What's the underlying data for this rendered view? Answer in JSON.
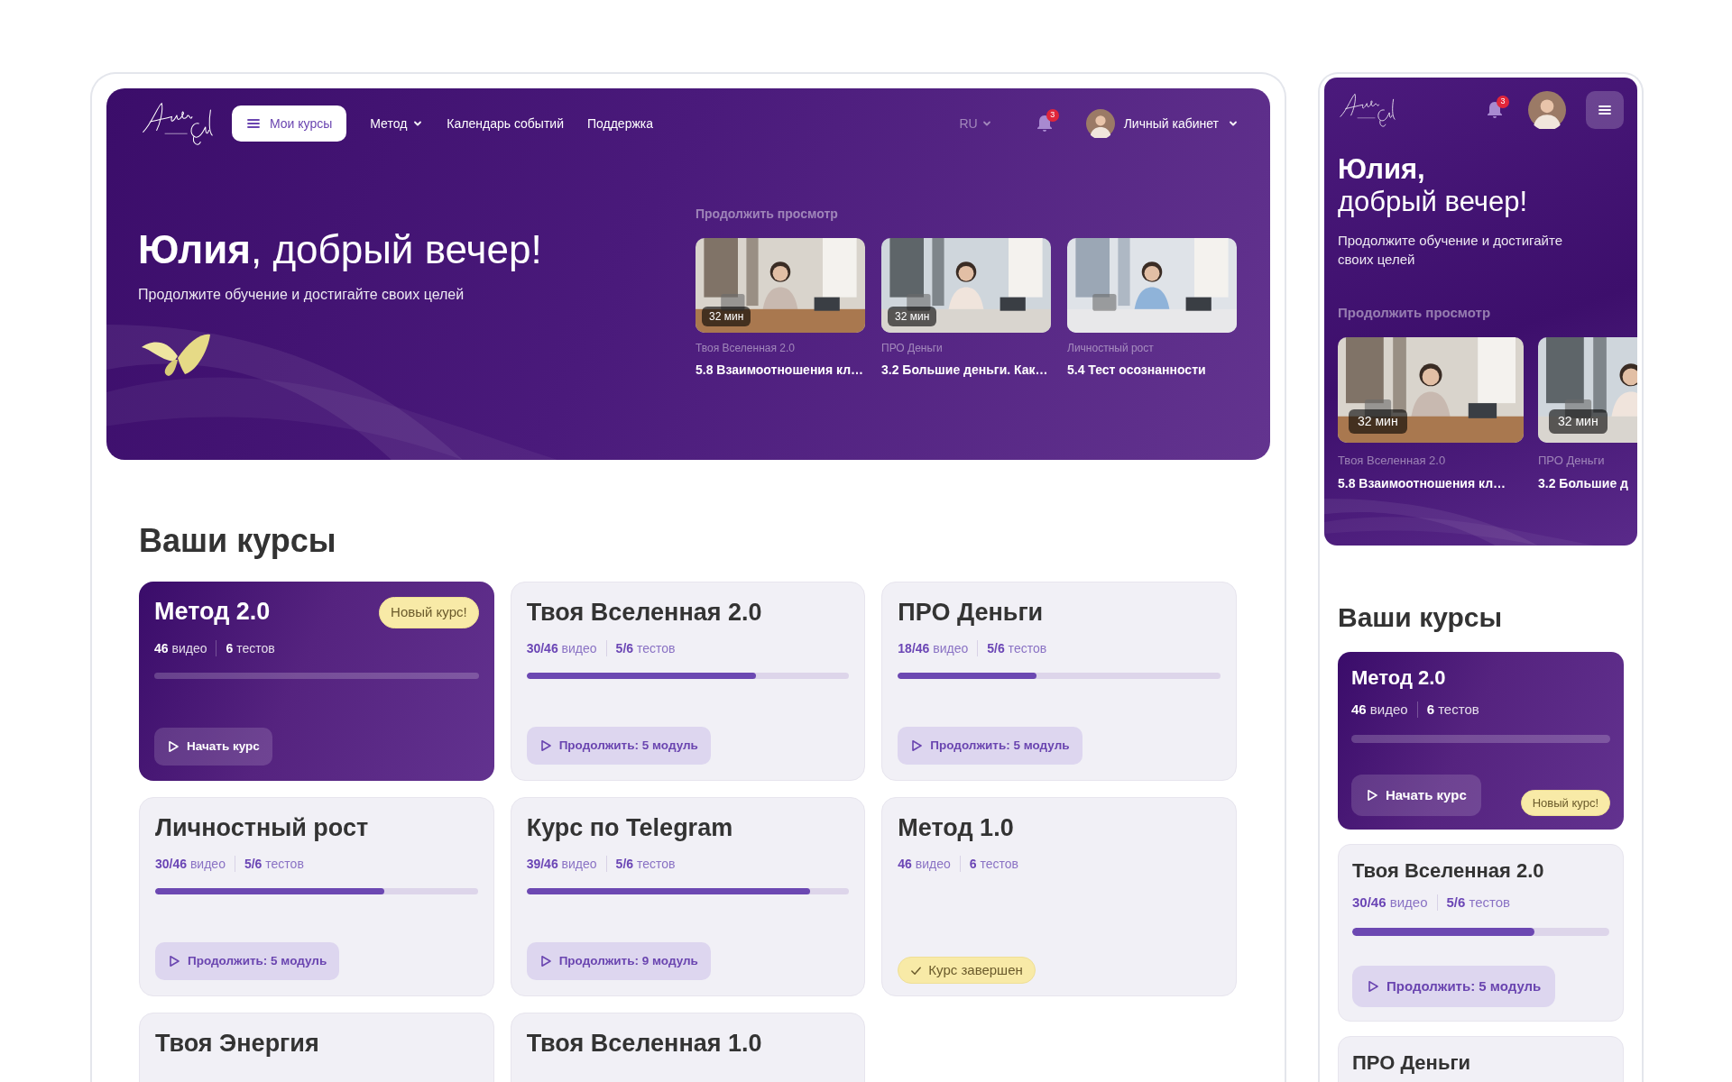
{
  "desktop": {
    "nav": {
      "menu_button": "Мои курсы",
      "links": [
        {
          "label": "Метод",
          "dropdown": true
        },
        {
          "label": "Календарь событий",
          "dropdown": false
        },
        {
          "label": "Поддержка",
          "dropdown": false
        }
      ],
      "language": "RU",
      "notifications": "3",
      "account": "Личный кабинет"
    },
    "greeting": "**Юлия**, добрый вечер!",
    "subtitle": "Продолжите обучение и достигайте своих целей",
    "continue_watching": {
      "label": "Продолжить просмотр",
      "items": [
        {
          "duration": "32 мин",
          "course": "Твоя Вселенная 2.0",
          "title": "5.8 Взаимоотношения кл…"
        },
        {
          "duration": "32 мин",
          "course": "ПРО Деньги",
          "title": "3.2 Большие деньги. Как…"
        },
        {
          "course": "Личностный рост",
          "title": "5.4 Тест осознанности"
        }
      ]
    },
    "courses_heading": "Ваши курсы",
    "courses": [
      {
        "title": "Метод 2.0",
        "featured": true,
        "badge": "Новый курс!",
        "videos": "**46** видео",
        "tests": "**6** тестов",
        "level": 0,
        "action": {
          "kind": "button",
          "label": "Начать курс"
        }
      },
      {
        "title": "Твоя Вселенная 2.0",
        "featured": false,
        "videos": "**30/46** видео",
        "tests": "**5/6** тестов",
        "level": 0.71,
        "action": {
          "kind": "button",
          "label": "Продолжить: 5 модуль"
        }
      },
      {
        "title": "ПРО Деньги",
        "featured": false,
        "videos": "**18/46** видео",
        "tests": "**5/6** тестов",
        "level": 0.43,
        "action": {
          "kind": "button",
          "label": "Продолжить: 5 модуль"
        }
      },
      {
        "title": "Личностный рост",
        "featured": false,
        "videos": "**30/46** видео",
        "tests": "**5/6** тестов",
        "level": 0.71,
        "action": {
          "kind": "button",
          "label": "Продолжить: 5 модуль"
        }
      },
      {
        "title": "Курс по Telegram",
        "featured": false,
        "videos": "**39/46** видео",
        "tests": "**5/6** тестов",
        "level": 0.88,
        "action": {
          "kind": "button",
          "label": "Продолжить: 9 модуль"
        }
      },
      {
        "title": "Метод 1.0",
        "featured": false,
        "videos": "**46** видео",
        "tests": "**6** тестов",
        "action": {
          "kind": "completed",
          "label": "Курс завершен"
        }
      },
      {
        "title": "Твоя Энергия",
        "featured": false
      },
      {
        "title": "Твоя Вселенная 1.0",
        "featured": false
      }
    ]
  },
  "mobile": {
    "nav": {
      "notifications": "3"
    },
    "greeting": "**Юлия,**\nдобрый вечер!",
    "subtitle": "Продолжите обучение и достигайте своих целей",
    "continue_watching": {
      "label": "Продолжить просмотр",
      "items": [
        {
          "duration": "32 мин",
          "course": "Твоя Вселенная 2.0",
          "title": "5.8 Взаимоотношения кл…"
        },
        {
          "duration": "32 мин",
          "course": "ПРО Деньги",
          "title": "3.2 Большие д"
        }
      ]
    },
    "courses_heading": "Ваши курсы",
    "courses": [
      {
        "title": "Метод 2.0",
        "featured": true,
        "badge": "Новый курс!",
        "videos": "**46** видео",
        "tests": "**6** тестов",
        "level": 0,
        "action": {
          "kind": "button",
          "label": "Начать курс"
        }
      },
      {
        "title": "Твоя Вселенная 2.0",
        "featured": false,
        "videos": "**30/46** видео",
        "tests": "**5/6** тестов",
        "level": 0.71,
        "action": {
          "kind": "button",
          "label": "Продолжить: 5 модуль"
        }
      },
      {
        "title": "ПРО Деньги",
        "featured": false
      }
    ]
  }
}
